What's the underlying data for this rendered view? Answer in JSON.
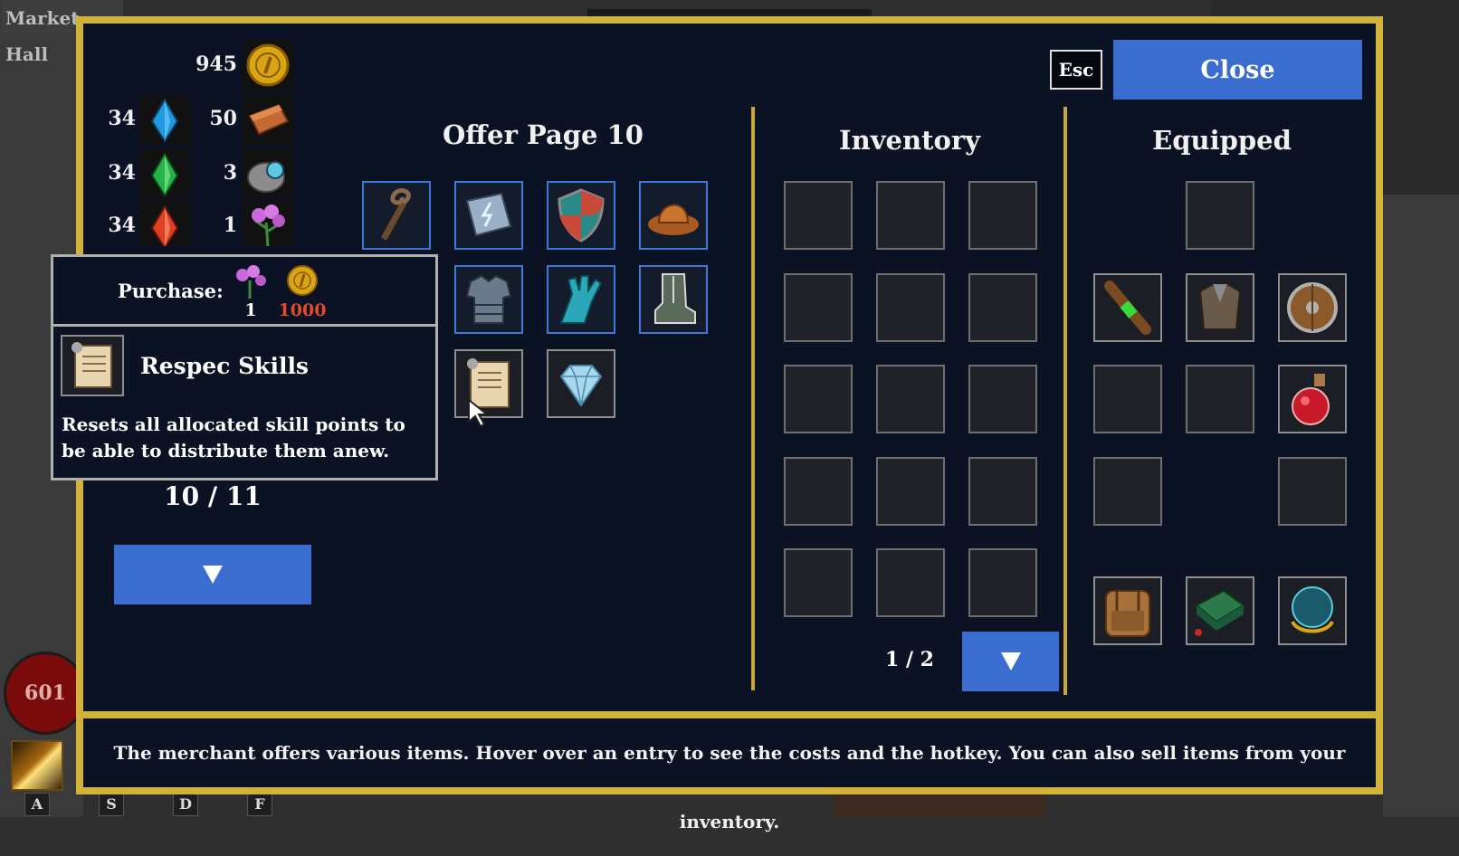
{
  "world": {
    "location_label": "Market Hall",
    "health": "601"
  },
  "hotkeys": [
    "A",
    "S",
    "D",
    "F"
  ],
  "resources": {
    "gold": "945",
    "items": [
      {
        "left_count": "34",
        "left_icon": "blue-crystal-icon",
        "right_count": "50",
        "right_icon": "copper-ingot-icon"
      },
      {
        "left_count": "34",
        "left_icon": "green-crystal-icon",
        "right_count": "3",
        "right_icon": "silver-ore-icon"
      },
      {
        "left_count": "34",
        "left_icon": "red-crystal-icon",
        "right_count": "1",
        "right_icon": "pink-flower-icon"
      }
    ]
  },
  "header": {
    "esc_label": "Esc",
    "close_label": "Close"
  },
  "offer": {
    "title": "Offer Page 10",
    "page_counter": "10 / 11",
    "items": [
      "staff-icon",
      "spellbook-icon",
      "shield-icon",
      "hat-icon",
      "chest-armor-icon",
      "gloves-icon",
      "boots-icon",
      "scroll-icon",
      "diamond-icon"
    ]
  },
  "tooltip": {
    "purchase_label": "Purchase:",
    "cost_flower": "1",
    "cost_gold": "1000",
    "item_name": "Respec Skills",
    "description": "Resets all allocated skill points to be able to distribute them anew."
  },
  "inventory": {
    "title": "Inventory",
    "page": "1 / 2"
  },
  "equipped": {
    "title": "Equipped",
    "items": [
      "wand-icon",
      "leather-vest-icon",
      "round-shield-icon",
      "health-potion-icon",
      "backpack-icon",
      "spellbook-case-icon",
      "crystal-orb-icon"
    ]
  },
  "footer": {
    "text": "The merchant offers various items. Hover over an entry to see the costs and the hotkey. You can also sell items from your inventory."
  },
  "colors": {
    "panel_border": "#d1b23a",
    "panel_bg": "#0a1224",
    "button_blue": "#3b6dd0",
    "cost_red": "#e24a2a"
  }
}
